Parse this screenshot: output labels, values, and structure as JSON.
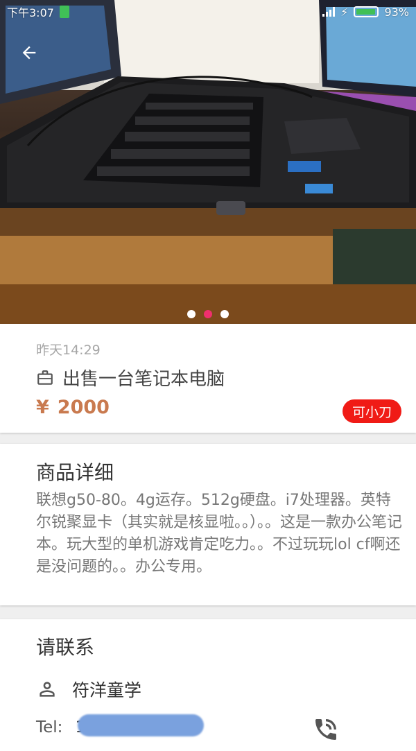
{
  "status_bar": {
    "time": "下午3:07",
    "battery_percent": "93%"
  },
  "gallery": {
    "image_count": 3,
    "active_index": 1
  },
  "item": {
    "posted_time": "昨天14:29",
    "title": "出售一台笔记本电脑",
    "price_symbol": "¥",
    "price": "2000",
    "negotiable_badge": "可小刀"
  },
  "details": {
    "section_title": "商品详细",
    "description": "联想g50-80。4g运存。512g硬盘。i7处理器。英特尔锐聚显卡（其实就是核显啦。。）。。这是一款办公笔记本。玩大型的单机游戏肯定吃力。。不过玩玩lol cf啊还是没问题的。。办公专用。"
  },
  "contact": {
    "section_title": "请联系",
    "name": "符洋童学",
    "tel_label": "Tel:",
    "tel_visible": "1"
  },
  "colors": {
    "price": "#c97a4f",
    "badge": "#f01b16",
    "dot_active": "#ef2f6e",
    "muted_text": "#a6a6a6"
  },
  "icons": {
    "back": "arrow-left",
    "title": "briefcase",
    "contact": "person",
    "call": "phone-in-talk"
  }
}
